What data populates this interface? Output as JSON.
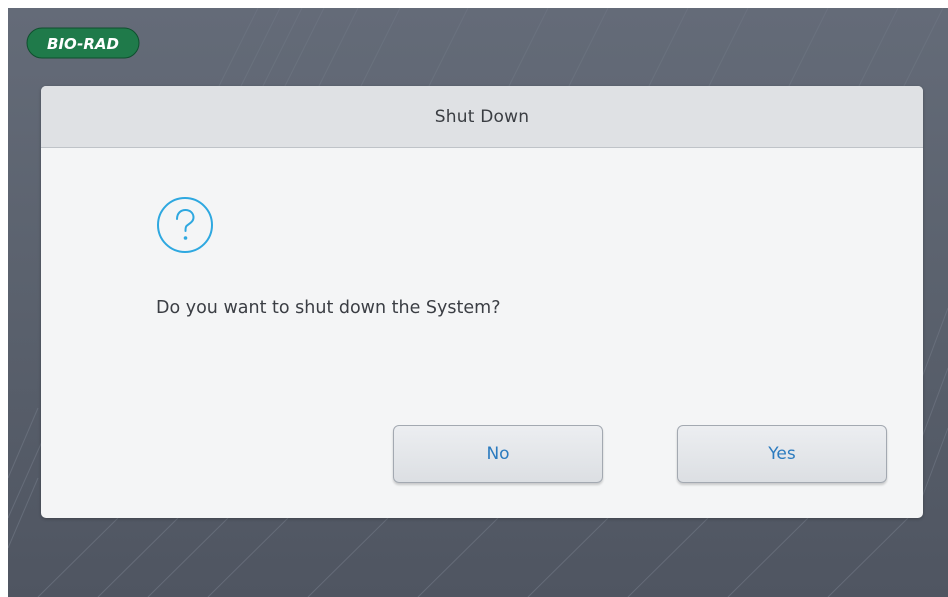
{
  "brand": {
    "logo_text": "BIO-RAD",
    "logo_color": "#1f7a4a"
  },
  "dialog": {
    "title": "Shut Down",
    "icon": "question-circle-icon",
    "icon_color": "#2ea8e0",
    "message": "Do you want to shut down the System?",
    "buttons": {
      "no_label": "No",
      "yes_label": "Yes"
    },
    "button_text_color": "#2b7bbf"
  },
  "background_color": "#5b6270"
}
